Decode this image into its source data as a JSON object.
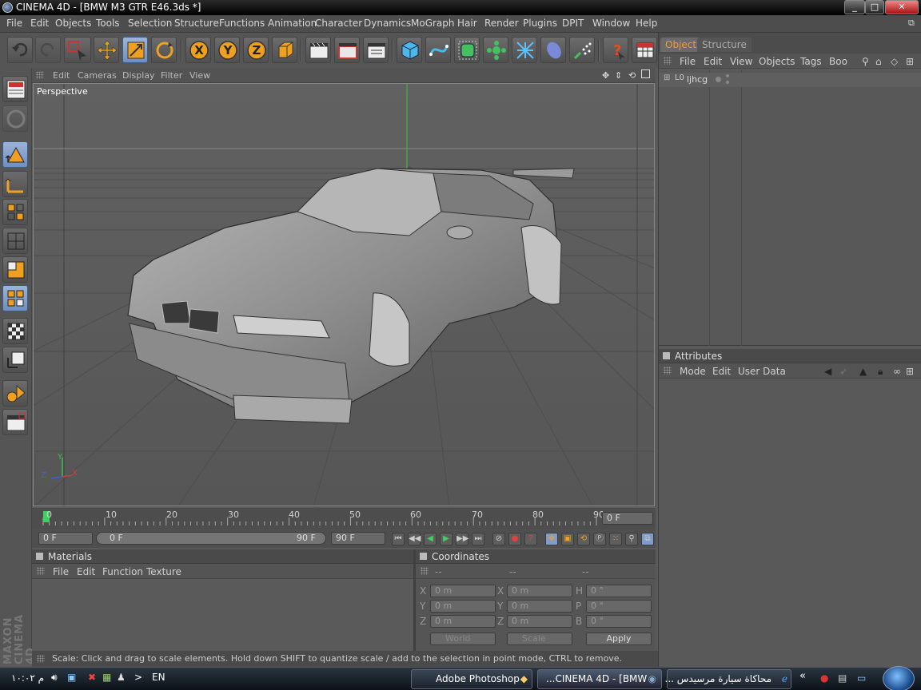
{
  "window": {
    "title": "CINEMA 4D - [BMW M3 GTR E46.3ds *]",
    "minimize": "_",
    "maximize": "□",
    "close": "✕"
  },
  "menubar": [
    "File",
    "Edit",
    "Objects",
    "Tools",
    "Selection",
    "Structure",
    "Functions",
    "Animation",
    "Character",
    "Dynamics",
    "MoGraph",
    "Hair",
    "Render",
    "Plugins",
    "DPIT",
    "Window",
    "Help"
  ],
  "viewport": {
    "menu": [
      "Edit",
      "Cameras",
      "Display",
      "Filter",
      "View"
    ],
    "label": "Perspective",
    "axis": {
      "x": "X",
      "y": "Y",
      "z": "Z"
    }
  },
  "timeline": {
    "ticks": [
      "0",
      "10",
      "20",
      "30",
      "40",
      "50",
      "60",
      "70",
      "80",
      "90"
    ],
    "current_frame": "0 F",
    "start_field": "0 F",
    "range_start": "0 F",
    "range_end": "90 F",
    "end_field": "90 F",
    "playhead_frame": 0,
    "max_frame": 90
  },
  "materials": {
    "title": "Materials",
    "menu": [
      "File",
      "Edit",
      "Function",
      "Texture"
    ]
  },
  "coordinates": {
    "title": "Coordinates",
    "col_headers": [
      "--",
      "--",
      "--"
    ],
    "rows": [
      {
        "a": "X",
        "av": "0 m",
        "b": "X",
        "bv": "0 m",
        "c": "H",
        "cv": "0 °"
      },
      {
        "a": "Y",
        "av": "0 m",
        "b": "Y",
        "bv": "0 m",
        "c": "P",
        "cv": "0 °"
      },
      {
        "a": "Z",
        "av": "0 m",
        "b": "Z",
        "bv": "0 m",
        "c": "B",
        "cv": "0 °"
      }
    ],
    "mode1": "World",
    "mode2": "Scale",
    "apply": "Apply"
  },
  "status": "Scale: Click and drag to scale elements. Hold down SHIFT to quantize scale / add to the selection in point mode, CTRL to remove.",
  "objects_panel": {
    "tabs": [
      "Objects",
      "Structure"
    ],
    "menu": [
      "File",
      "Edit",
      "View",
      "Objects",
      "Tags",
      "Boo"
    ],
    "items": [
      {
        "name": "ljhcg"
      }
    ]
  },
  "attributes_panel": {
    "title": "Attributes",
    "menu": [
      "Mode",
      "Edit",
      "User Data"
    ]
  },
  "brand": "MAXON CINEMA 4D",
  "taskbar": {
    "clock": "۱۰:۰۲ م",
    "lang": "EN",
    "arrow": ">",
    "tasks": [
      "Adobe Photoshop",
      "...CINEMA 4D - [BMW",
      "محاكاة سيارة مرسيدس ..."
    ],
    "chevron": "«"
  },
  "colors": {
    "accent": "#f0a020",
    "active_tool": "#7f9ccb",
    "timeline_marker": "#40d060"
  }
}
